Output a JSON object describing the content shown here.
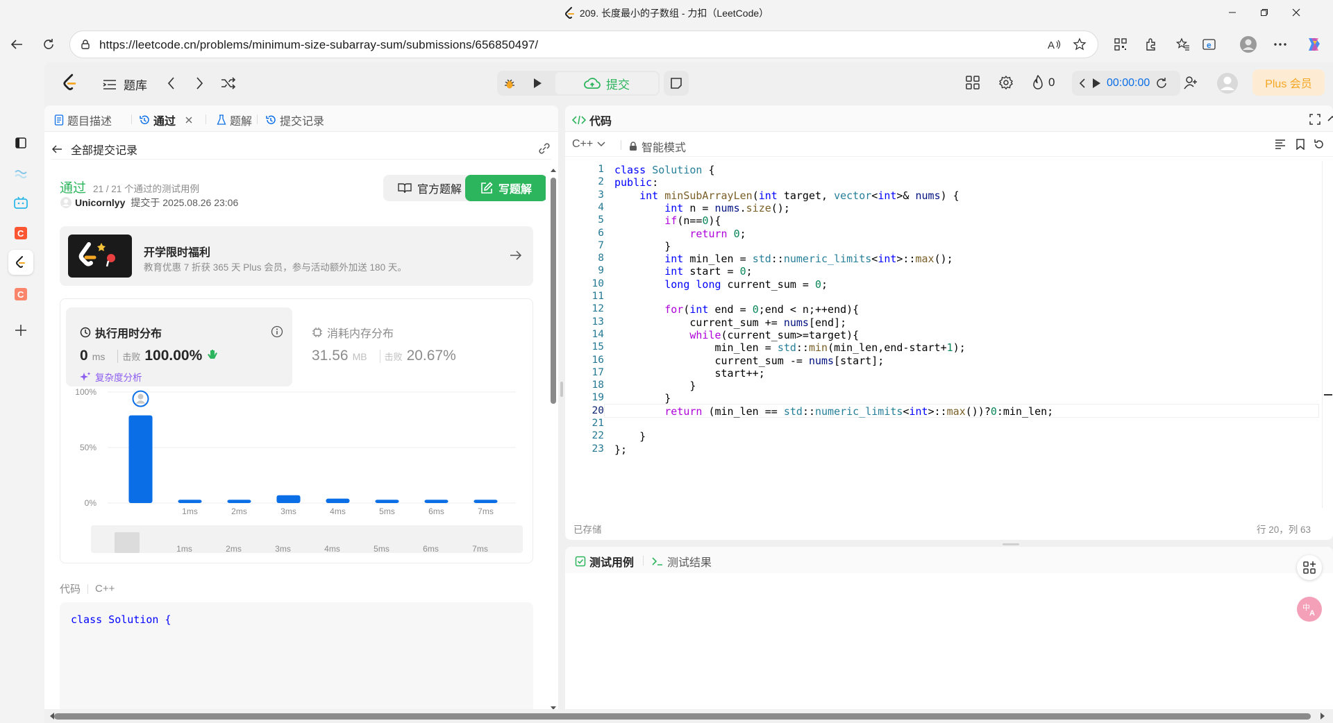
{
  "window": {
    "title": "209. 长度最小的子数组 - 力扣（LeetCode）"
  },
  "browser": {
    "url": "https://leetcode.cn/problems/minimum-size-subarray-sum/submissions/656850497/"
  },
  "nav": {
    "problem_list": "题库",
    "submit": "提交",
    "streak": "0",
    "timer": "00:00:00",
    "plus": "Plus 会员"
  },
  "left_tabs": [
    {
      "label": "题目描述"
    },
    {
      "label": "通过"
    },
    {
      "label": "题解"
    },
    {
      "label": "提交记录"
    }
  ],
  "back_link": "全部提交记录",
  "submission": {
    "status": "通过",
    "cases": "21 / 21 个通过的测试用例",
    "user": "Unicornlyy",
    "submitted_at": "提交于 2025.08.26 23:06",
    "official_solution": "官方题解",
    "write_solution": "写题解"
  },
  "promo": {
    "title": "开学限时福利",
    "desc": "教育优惠 7 折获 365 天 Plus 会员，参与活动额外加送 180 天。"
  },
  "runtime": {
    "title": "执行用时分布",
    "value": "0",
    "unit": "ms",
    "beats_label": "击败",
    "beats": "100.00%",
    "complexity": "复杂度分析"
  },
  "memory": {
    "title": "消耗内存分布",
    "value": "31.56",
    "unit": "MB",
    "beats_label": "击败",
    "beats": "20.67%"
  },
  "chart_data": {
    "type": "bar",
    "y_ticks": [
      "100%",
      "50%",
      "0%"
    ],
    "ylim": [
      0,
      100
    ],
    "categories": [
      "0ms",
      "1ms",
      "2ms",
      "3ms",
      "4ms",
      "5ms",
      "6ms",
      "7ms"
    ],
    "x_tick_labels": [
      "",
      "1ms",
      "2ms",
      "3ms",
      "4ms",
      "5ms",
      "6ms",
      "7ms"
    ],
    "values": [
      79,
      3,
      3,
      7,
      4,
      3,
      3,
      3
    ],
    "highlight_category": "0ms",
    "bar_color": "#0a6ee6",
    "grid": true
  },
  "code_section": {
    "label": "代码",
    "lang": "C++",
    "preview": "class Solution {"
  },
  "editor": {
    "title": "代码",
    "lang": "C++",
    "mode": "智能模式",
    "saved": "已存储",
    "cursor": "行 20，列 63",
    "lines": [
      "class Solution {",
      "public:",
      "    int minSubArrayLen(int target, vector<int>& nums) {",
      "        int n = nums.size();",
      "        if(n==0){",
      "            return 0;",
      "        }",
      "        int min_len = std::numeric_limits<int>::max();",
      "        int start = 0;",
      "        long long current_sum = 0;",
      "",
      "        for(int end = 0;end < n;++end){",
      "            current_sum += nums[end];",
      "            while(current_sum>=target){",
      "                min_len = std::min(min_len,end-start+1);",
      "                current_sum -= nums[start];",
      "                start++;",
      "            }",
      "        }",
      "        return (min_len == std::numeric_limits<int>::max())?0:min_len;",
      "",
      "    }",
      "};"
    ]
  },
  "bottom": {
    "test_cases": "测试用例",
    "test_result": "测试结果"
  },
  "colors": {
    "accent_green": "#2db55d",
    "blue": "#0a6ee6",
    "plus": "#f5a623"
  }
}
